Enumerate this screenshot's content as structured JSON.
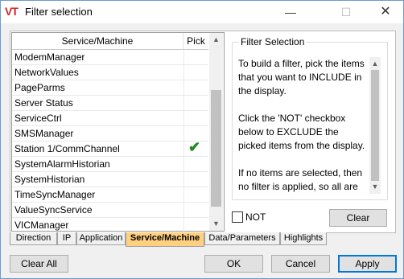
{
  "window": {
    "title": "Filter selection",
    "icon_text": "VT",
    "minimize_glyph": "—",
    "maximize_glyph": "☐",
    "close_glyph": "✕"
  },
  "list": {
    "headers": {
      "service": "Service/Machine",
      "pick": "Pick"
    },
    "rows": [
      {
        "name": "ModemManager",
        "picked": false
      },
      {
        "name": "NetworkValues",
        "picked": false
      },
      {
        "name": "PageParms",
        "picked": false
      },
      {
        "name": "Server Status",
        "picked": false
      },
      {
        "name": "ServiceCtrl",
        "picked": false
      },
      {
        "name": "SMSManager",
        "picked": false
      },
      {
        "name": "Station 1/CommChannel",
        "picked": true
      },
      {
        "name": "SystemAlarmHistorian",
        "picked": false
      },
      {
        "name": "SystemHistorian",
        "picked": false
      },
      {
        "name": "TimeSyncManager",
        "picked": false
      },
      {
        "name": "ValueSyncService",
        "picked": false
      },
      {
        "name": "VICManager",
        "picked": false
      }
    ],
    "check_glyph": "✔",
    "scroll_position": 0.8
  },
  "filter_selection": {
    "title": "Filter Selection",
    "text": "To build a filter, pick the items that you want to INCLUDE in the display.\n\nClick the 'NOT' checkbox below to EXCLUDE the picked items from the display.\n\nIf no items are selected, then no filter is applied, so all are included.",
    "not_label": "NOT",
    "not_checked": false,
    "clear_label": "Clear"
  },
  "tabs": [
    "Direction",
    "IP",
    "Application",
    "Service/Machine",
    "Data/Parameters",
    "Highlights"
  ],
  "active_tab": "Service/Machine",
  "buttons": {
    "clear_all": "Clear All",
    "ok": "OK",
    "cancel": "Cancel",
    "apply": "Apply"
  },
  "colors": {
    "active_tab": "#ffd080",
    "check": "#1e8a1e",
    "default_button_border": "#0078d7",
    "app_icon": "#d2232a"
  }
}
